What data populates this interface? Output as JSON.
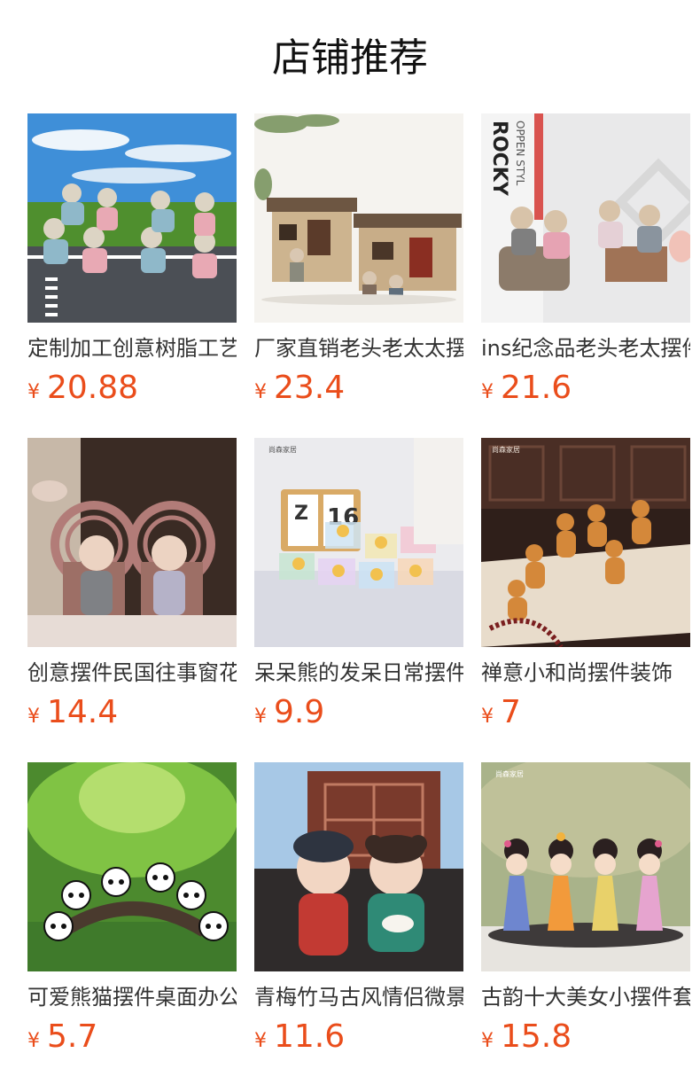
{
  "header": {
    "title": "店铺推荐"
  },
  "currency_symbol": "¥",
  "products": [
    {
      "name": "定制加工创意树脂工艺品",
      "price": "20.88"
    },
    {
      "name": "厂家直销老头老太太摆件",
      "price": "23.4"
    },
    {
      "name": "ins纪念品老头老太摆件",
      "price": "21.6"
    },
    {
      "name": "创意摆件民国往事窗花",
      "price": "14.4"
    },
    {
      "name": "呆呆熊的发呆日常摆件",
      "price": "9.9"
    },
    {
      "name": "禅意小和尚摆件装饰",
      "price": "7"
    },
    {
      "name": "可爱熊猫摆件桌面办公",
      "price": "5.7"
    },
    {
      "name": "青梅竹马古风情侣微景",
      "price": "11.6"
    },
    {
      "name": "古韵十大美女小摆件套装",
      "price": "15.8"
    }
  ],
  "image_brand_text": "尚森家居"
}
